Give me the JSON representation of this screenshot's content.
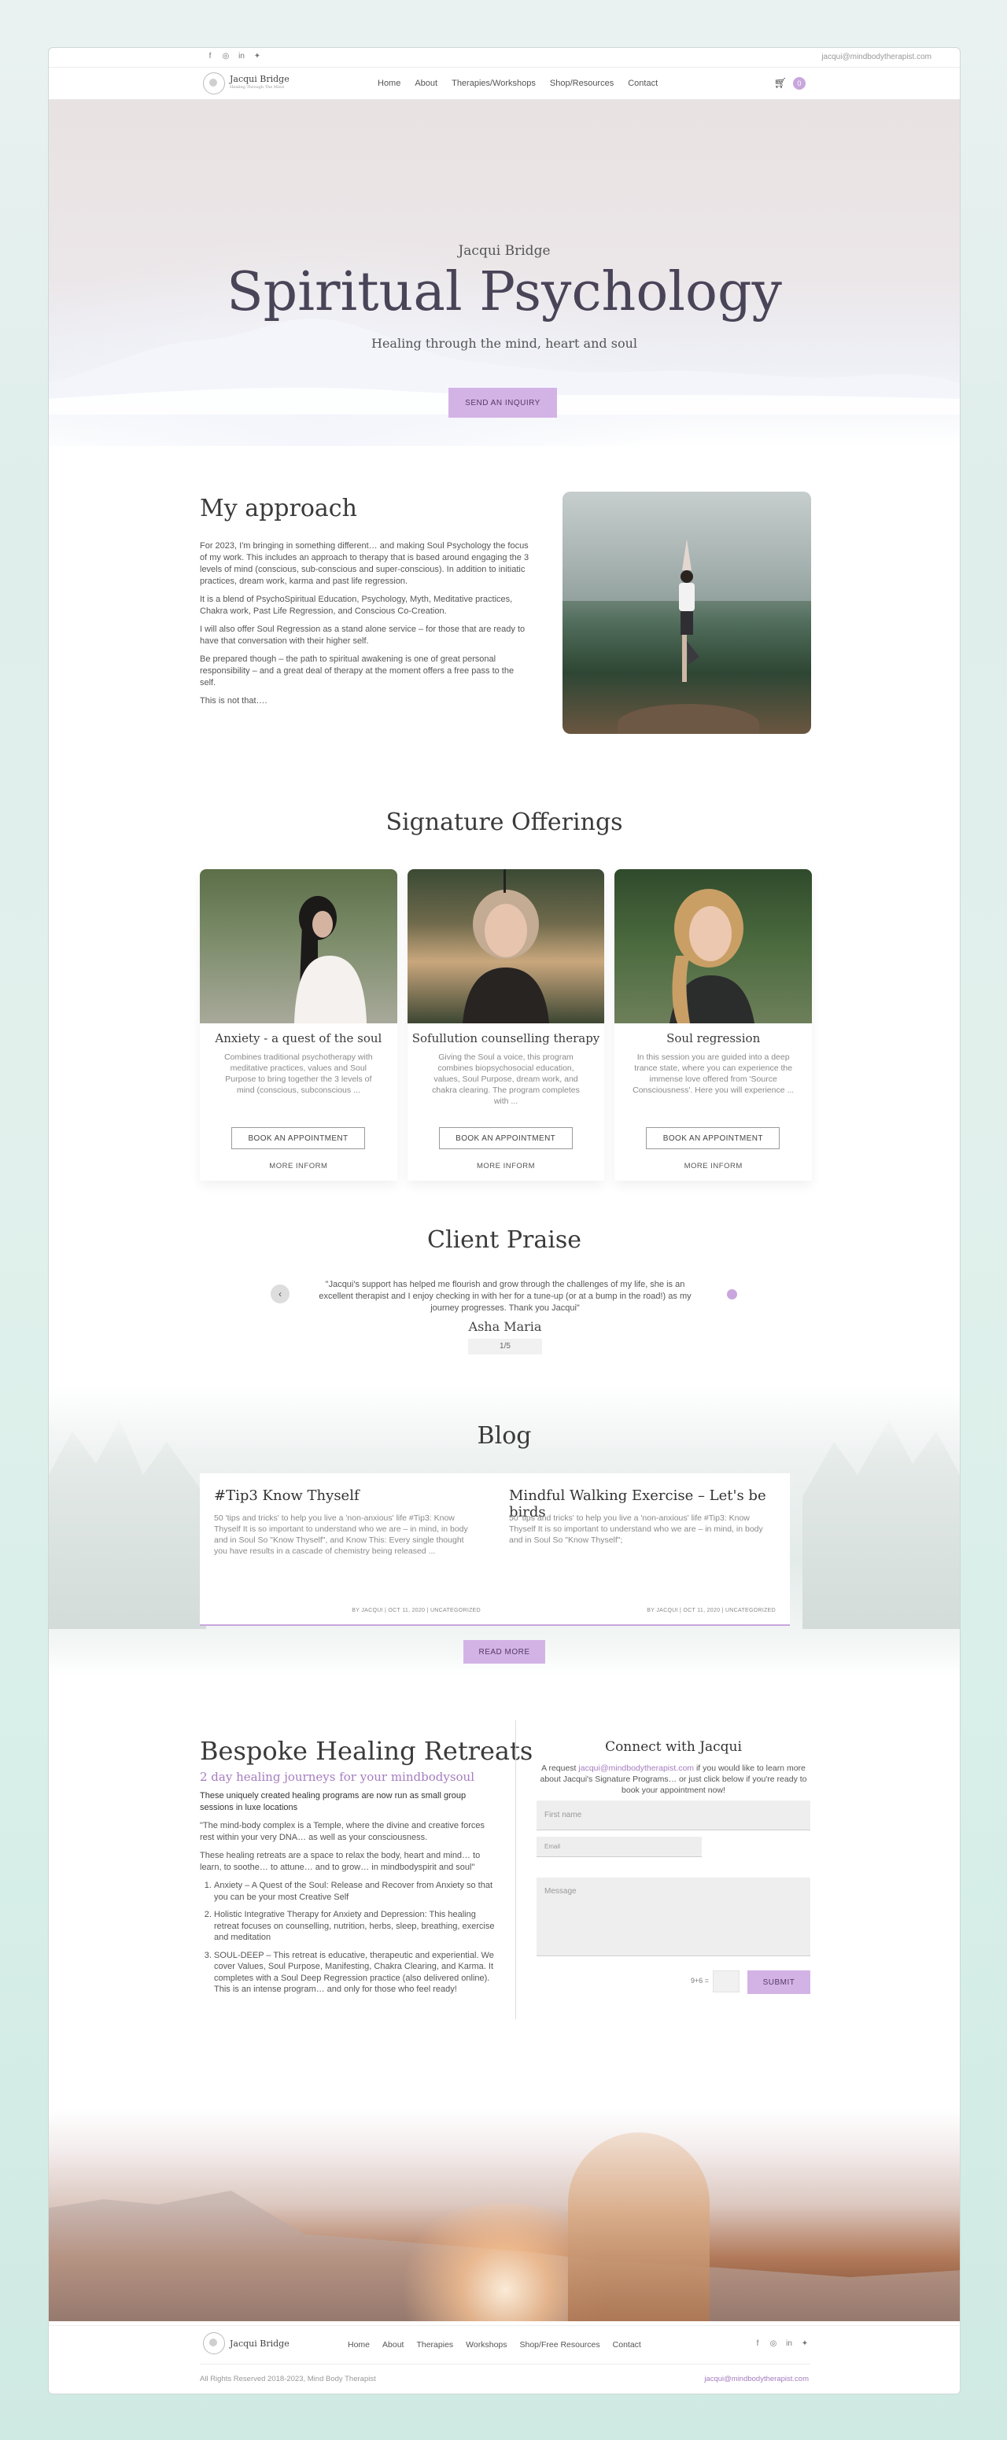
{
  "topbar": {
    "socials": [
      "facebook-icon",
      "instagram-icon",
      "linkedin-icon",
      "twitter-icon"
    ],
    "email": "jacqui@mindbodytherapist.com"
  },
  "header": {
    "logo_name": "Jacqui Bridge",
    "logo_tagline": "Healing Through The Mind",
    "nav": [
      "Home",
      "About",
      "Therapies/Workshops",
      "Shop/Resources",
      "Contact"
    ],
    "cart_count": "0"
  },
  "hero": {
    "name": "Jacqui Bridge",
    "title": "Spiritual Psychology",
    "tagline": "Healing through the mind, heart and soul",
    "cta": "SEND AN INQUIRY"
  },
  "approach": {
    "title": "My approach",
    "paragraphs": [
      "For 2023, I'm bringing in something different… and making Soul Psychology the focus of my work. This includes an approach to therapy that is based around engaging the 3 levels of mind (conscious, sub-conscious and super-conscious). In addition to initiatic practices, dream work, karma and past life regression.",
      "It is a blend of PsychoSpiritual Education, Psychology, Myth, Meditative practices, Chakra work, Past Life Regression, and Conscious Co-Creation.",
      "I will also offer Soul Regression as a stand alone service – for those that are ready to have that conversation with their higher self.",
      "Be prepared though – the path to spiritual awakening is one of great personal responsibility – and a great deal of therapy at the moment offers a free pass to the self.",
      "This is not that…."
    ]
  },
  "offerings": {
    "title": "Signature Offerings",
    "cards": [
      {
        "title": "Anxiety - a quest of the soul",
        "desc": "Combines traditional psychotherapy with meditative practices, values and Soul Purpose to bring together the 3 levels of mind (conscious, subconscious ...",
        "button": "BOOK AN APPOINTMENT",
        "more": "MORE INFORM"
      },
      {
        "title": "Sofullution counselling therapy",
        "desc": "Giving the Soul a voice, this program combines biopsychosocial education, values, Soul Purpose, dream work, and chakra clearing. The program completes with ...",
        "button": "BOOK AN APPOINTMENT",
        "more": "MORE INFORM"
      },
      {
        "title": "Soul regression",
        "desc": "In this session you are guided into a deep trance state, where you can experience the immense love offered from 'Source Consciousness'. Here you will experience ...",
        "button": "BOOK AN APPOINTMENT",
        "more": "MORE INFORM"
      }
    ]
  },
  "praise": {
    "title": "Client Praise",
    "quote": "\"Jacqui's support has helped me flourish and grow through the challenges of my life, she is an excellent therapist and I enjoy checking in with her for a tune-up (or at a bump in the road!) as my journey progresses. Thank you Jacqui\"",
    "author": "Asha Maria",
    "pager": "1/5"
  },
  "blog": {
    "title": "Blog",
    "posts": [
      {
        "title": "#Tip3 Know Thyself",
        "desc": "50 'tips and tricks' to help you live a 'non-anxious' life #Tip3: Know Thyself It is so important to understand who we are – in mind, in body and in Soul So \"Know Thyself\", and Know This: Every single thought you have results in a cascade of chemistry being released ...",
        "meta": "BY JACQUI | OCT 11, 2020 | UNCATEGORIZED"
      },
      {
        "title": "Mindful Walking Exercise – Let's be birds",
        "desc": "50 'tips and tricks' to help you live a 'non-anxious' life #Tip3: Know Thyself It is so important to understand who we are – in mind, in body and in Soul So \"Know Thyself\";",
        "meta": "BY JACQUI | OCT 11, 2020 | UNCATEGORIZED"
      }
    ],
    "readmore": "READ MORE"
  },
  "retreats": {
    "title": "Bespoke Healing Retreats",
    "subtitle": "2 day healing journeys for your mindbodysoul",
    "lead": "These uniquely created healing programs are now run as small group sessions in luxe locations",
    "p1": "\"The mind-body complex is a Temple, where the divine and creative forces rest within your very DNA… as well as your consciousness.",
    "p2": "These healing retreats are a space to relax the body, heart and mind… to learn, to soothe… to attune… and to grow… in mindbodyspirit and soul\"",
    "list": [
      "Anxiety – A Quest of the Soul: Release and Recover from Anxiety so that you can be your most Creative Self",
      "Holistic Integrative Therapy for Anxiety and Depression: This healing retreat focuses on counselling, nutrition, herbs, sleep, breathing, exercise and meditation",
      "SOUL-DEEP – This retreat is educative, therapeutic and experiential. We cover Values, Soul Purpose, Manifesting, Chakra Clearing, and Karma. It completes with a Soul Deep Regression practice (also delivered online). This is an intense program… and only for those who feel ready!"
    ]
  },
  "contact": {
    "title": "Connect with Jacqui",
    "intro_pre": "A request ",
    "intro_link": "jacqui@mindbodytherapist.com",
    "intro_post": " if you would like to learn more about Jacqui's Signature Programs… or just click below if you're ready to book your appointment now!",
    "first_name": "First name",
    "email": "Email",
    "message": "Message",
    "captcha": "9+6 =",
    "submit": "SUBMIT"
  },
  "footer": {
    "logo_name": "Jacqui Bridge",
    "nav": [
      "Home",
      "About",
      "Therapies",
      "Workshops",
      "Shop/Free Resources",
      "Contact"
    ],
    "socials": [
      "facebook-icon",
      "instagram-icon",
      "linkedin-icon",
      "twitter-icon"
    ],
    "copyright": "All Rights Reserved 2018-2023, Mind Body Therapist",
    "email": "jacqui@mindbodytherapist.com"
  },
  "colors": {
    "accent": "#d3b3e6",
    "accent_text": "#a57dbf",
    "background": "#dfeeeb"
  }
}
